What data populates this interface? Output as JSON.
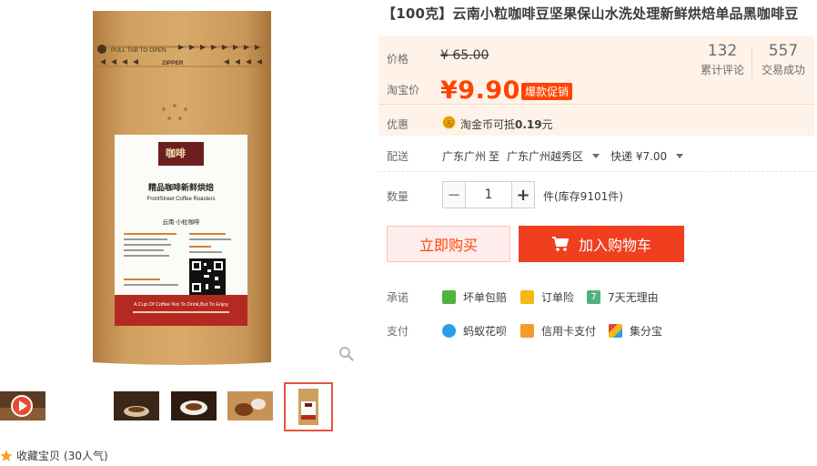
{
  "product": {
    "title": "【100克】云南小粒咖啡豆坚果保山水洗处理新鲜烘焙单品黑咖啡豆"
  },
  "gallery": {
    "pack_top_text": "PULL TAB TO OPEN",
    "pack_zipper_text": "ZIPPER",
    "brand_cn": "咖啡",
    "label_title": "精品咖啡新鲜烘焙",
    "label_sub": "FrontStreet Coffee Roasters",
    "label_product": "云南·小粒咖啡",
    "label_footer": "A Cup Of Coffee Not To Drink,But To Enjoy",
    "thumb_count": 5,
    "selected_thumb": 5
  },
  "favorite": {
    "label": "收藏宝贝",
    "count": "(30人气)"
  },
  "price": {
    "label": "价格",
    "original": "¥ 65.00",
    "taobao_label": "淘宝价",
    "current": "¥9.90",
    "badge": "爆款促销"
  },
  "stats": [
    {
      "num": "132",
      "label": "累计评论"
    },
    {
      "num": "557",
      "label": "交易成功"
    }
  ],
  "discount": {
    "label": "优惠",
    "text": "淘金币可抵",
    "amount": "0.19",
    "unit": "元"
  },
  "shipping": {
    "label": "配送",
    "from": "广东广州",
    "to_word": "至",
    "to": "广东广州越秀区",
    "method": "快递 ¥7.00"
  },
  "quantity": {
    "label": "数量",
    "value": "1",
    "minus": "−",
    "plus": "+",
    "stock": "件(库存9101件)"
  },
  "actions": {
    "buy_now": "立即购买",
    "add_cart": "加入购物车"
  },
  "promise": {
    "label": "承诺",
    "items": [
      "坏单包赔",
      "订单险",
      "7天无理由"
    ]
  },
  "payment": {
    "label": "支付",
    "items": [
      "蚂蚁花呗",
      "信用卡支付",
      "集分宝"
    ]
  },
  "colors": {
    "accent": "#ff4400",
    "price_bg": "#fff2e8",
    "cart_btn": "#ef3f1f"
  }
}
